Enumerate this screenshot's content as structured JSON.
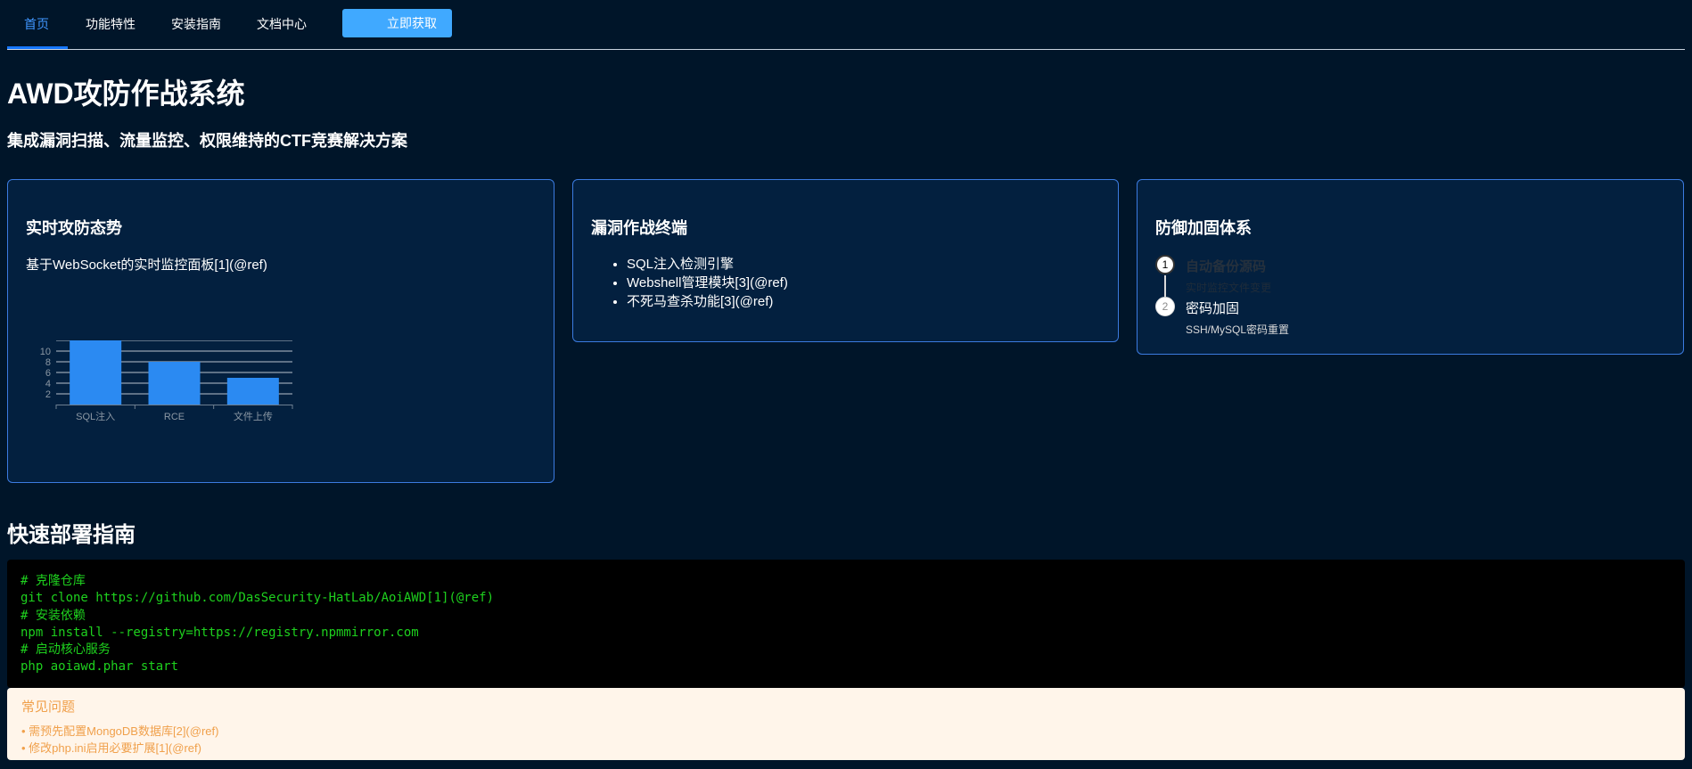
{
  "nav": {
    "items": [
      {
        "label": "首页",
        "active": true
      },
      {
        "label": "功能特性"
      },
      {
        "label": "安装指南"
      },
      {
        "label": "文档中心"
      }
    ],
    "cta_label": "立即获取"
  },
  "hero": {
    "title": "AWD攻防作战系统",
    "subtitle": "集成漏洞扫描、流量监控、权限维持的CTF竞赛解决方案"
  },
  "cards": {
    "realtime": {
      "title": "实时攻防态势",
      "text": "基于WebSocket的实时监控面板[1](@ref)"
    },
    "terminal": {
      "title": "漏洞作战终端",
      "items": [
        "SQL注入检测引擎",
        "Webshell管理模块[3](@ref)",
        "不死马查杀功能[3](@ref)"
      ]
    },
    "defense": {
      "title": "防御加固体系",
      "steps": [
        {
          "number": "1",
          "title": "自动备份源码",
          "desc": "实时监控文件变更"
        },
        {
          "number": "2",
          "title": "密码加固",
          "desc": "SSH/MySQL密码重置"
        }
      ]
    }
  },
  "chart_data": {
    "type": "bar",
    "categories": [
      "SQL注入",
      "RCE",
      "文件上传"
    ],
    "values": [
      12,
      8,
      5
    ],
    "yticks": [
      2,
      4,
      6,
      8,
      10
    ],
    "ylim": [
      0,
      12
    ],
    "grid": true,
    "title": "",
    "xlabel": "",
    "ylabel": "",
    "colors": {
      "bar": "#2b8af2",
      "axis": "#6e7f91",
      "grid": "#b8c2cc",
      "tick": "#8c98a4"
    }
  },
  "deploy": {
    "title": "快速部署指南",
    "code_lines": [
      "# 克隆仓库",
      "git clone https://github.com/DasSecurity-HatLab/AoiAWD[1](@ref)",
      "# 安装依赖",
      "npm install --registry=https://registry.npmmirror.com",
      "# 启动核心服务",
      "php aoiawd.phar start"
    ]
  },
  "faq": {
    "title": "常见问题",
    "items": [
      "• 需预先配置MongoDB数据库[2](@ref)",
      "• 修改php.ini启用必要扩展[1](@ref)"
    ]
  },
  "colors": {
    "background": "#001529",
    "accent": "#1677ff",
    "card_border": "#3b7be0",
    "code_text": "#1ed11e",
    "faq_text": "#f0a04b"
  }
}
